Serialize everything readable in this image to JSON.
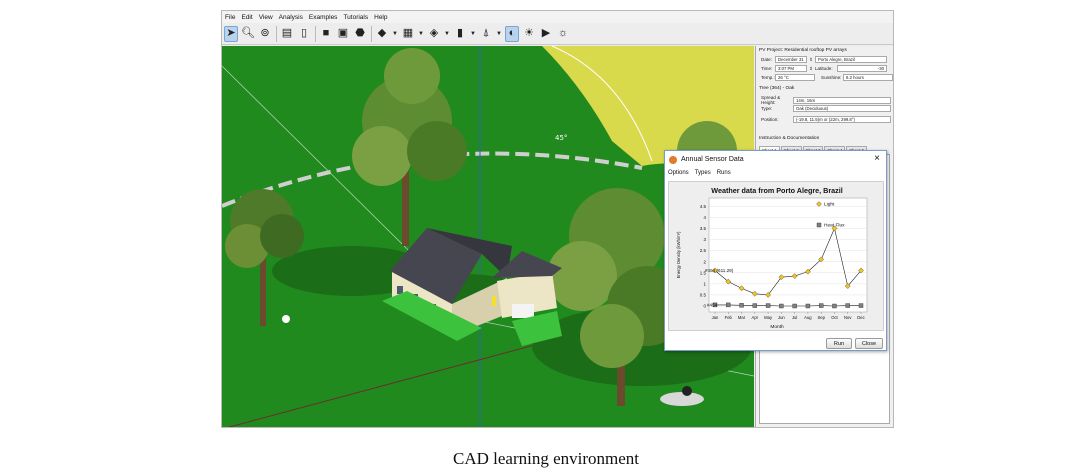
{
  "app": {
    "menu": [
      "File",
      "Edit",
      "View",
      "Analysis",
      "Examples",
      "Tutorials",
      "Help"
    ],
    "toolbar_icons": [
      "select-pointer-icon",
      "zoom-icon",
      "rotate-view-icon",
      "printer-icon",
      "notes-icon",
      "building-icon",
      "wall-icon",
      "roof-icon",
      "panel-icon",
      "rack-icon",
      "window-icon",
      "door-icon",
      "shadow-icon",
      "sun-icon",
      "animation-icon",
      "heliodon-icon"
    ]
  },
  "scene": {
    "angle_label": "45°"
  },
  "panel": {
    "header": "PV Project: Residential rooftop PV arrays",
    "date_label": "Date:",
    "date_value": "December 31",
    "location_value": "Porto Alegre, Brazil",
    "time_label": "Time:",
    "time_value": "3:07 PM",
    "latitude_label": "Latitude:",
    "latitude_value": "-30",
    "temp_label": "Temp.:",
    "temp_value": "26 °C",
    "sunshine_label": "Sunshine:",
    "sunshine_value": "8.2 hours",
    "tree_header": "Tree (364) - Oak",
    "spread_label": "Spread & Height:",
    "spread_value": "14m, 16m",
    "type_label": "Type:",
    "type_value": "Oak (Deciduous)",
    "position_label": "Position:",
    "position_value": "(-19.8, 11.5)m or (22m, 299.8°)",
    "instruction_header": "Instruction & Documentation",
    "sheets": [
      "Sheet 1",
      "Sheet 2",
      "Sheet 3",
      "Sheet 4",
      "Sheet 5"
    ]
  },
  "dialog": {
    "title": "Annual Sensor Data",
    "menu": [
      "Options",
      "Types",
      "Runs"
    ],
    "run_button": "Run",
    "close_button": "Close"
  },
  "chart_data": {
    "type": "line",
    "title": "Weather data from Porto Alegre, Brazil",
    "xlabel": "Month",
    "ylabel": "Energy Density (kWh/m²)",
    "categories": [
      "Jan",
      "Feb",
      "Mar",
      "Apr",
      "May",
      "Jun",
      "Jul",
      "Aug",
      "Sep",
      "Oct",
      "Nov",
      "Dec"
    ],
    "yticks": [
      "0",
      "0.5",
      "1",
      "1.5",
      "2",
      "2.5",
      "3",
      "3.5",
      "4",
      "4.5"
    ],
    "ylim": [
      0,
      4.6
    ],
    "series": [
      {
        "name": "Light",
        "color": "#f0c419",
        "marker": "diamond",
        "values": [
          1.6,
          1.1,
          0.8,
          0.55,
          0.5,
          1.3,
          1.35,
          1.55,
          2.1,
          3.5,
          0.9,
          1.6
        ]
      },
      {
        "name": "Heat Flux",
        "color": "#808080",
        "marker": "square",
        "values": [
          0.05,
          0.05,
          0.03,
          0.02,
          0.02,
          0.0,
          0.0,
          0.0,
          0.02,
          0.0,
          0.02,
          0.02
        ]
      }
    ],
    "annotations": [
      "#454 (611.29)",
      "#454"
    ],
    "legend_position": "right",
    "grid": true
  },
  "caption": "CAD learning environment"
}
